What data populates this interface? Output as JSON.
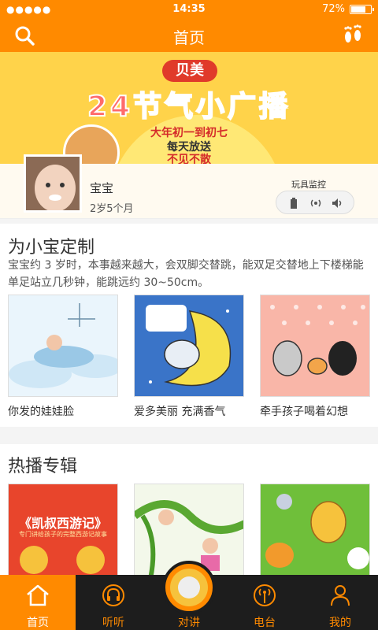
{
  "status_bar": {
    "signal": "●●●●●",
    "time": "14:35",
    "battery": "72%"
  },
  "navbar": {
    "title": "首页"
  },
  "banner": {
    "brand": "贝美",
    "headline": "24节气小广播",
    "line1": "大年初一到初七",
    "line2": "每天放送",
    "line3": "不见不散"
  },
  "profile": {
    "name": "宝宝",
    "age": "2岁5个月",
    "monitor_label": "玩具监控"
  },
  "custom": {
    "title": "为小宝定制",
    "description": "宝宝约 3 岁时，本事越来越大，会双脚交替跳，能双足交替地上下楼梯能单足站立几秒钟，能跳远约 30~50cm。",
    "cards": [
      {
        "label": "你发的娃娃脸"
      },
      {
        "label": "爱多美丽 充满香气"
      },
      {
        "label": "牵手孩子喝着幻想"
      }
    ]
  },
  "hot": {
    "title": "热播专辑",
    "albums": [
      {
        "title": "《凯叔西游记》",
        "subtitle": "专门讲给孩子的完整西游记故事"
      },
      {
        "title": ""
      },
      {
        "title": ""
      }
    ]
  },
  "tabbar": {
    "tabs": [
      {
        "label": "首页"
      },
      {
        "label": "听听"
      },
      {
        "label": "对讲"
      },
      {
        "label": "电台"
      },
      {
        "label": "我的"
      }
    ]
  },
  "colors": {
    "accent": "#ff8a00",
    "tabbar_bg": "#1d1d1d",
    "banner_bg": "#ffd34a"
  }
}
